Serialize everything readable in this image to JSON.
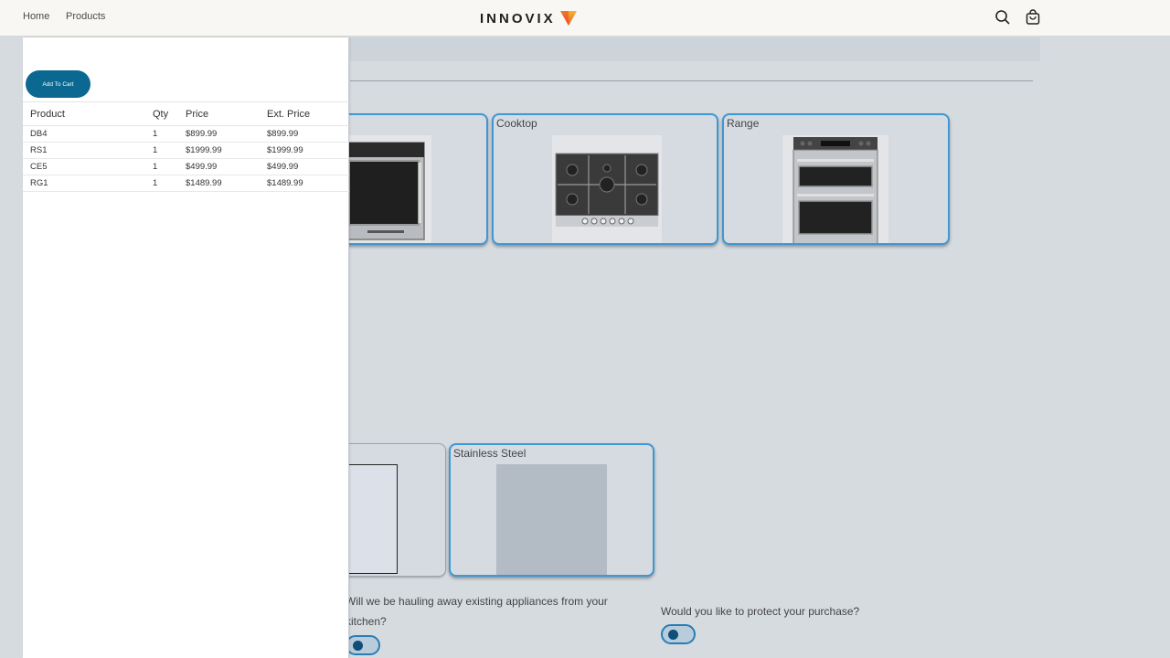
{
  "header": {
    "nav": [
      {
        "label": "Home"
      },
      {
        "label": "Products"
      }
    ],
    "logo_text": "INNOVIX",
    "icons": [
      "search-icon",
      "cart-icon"
    ],
    "logo_colors": [
      "#f05a28",
      "#f7b52c"
    ]
  },
  "product_cards": [
    {
      "label": ""
    },
    {
      "label": "Cooktop"
    },
    {
      "label": "Range"
    }
  ],
  "finish_cards": [
    {
      "label": ""
    },
    {
      "label": "Stainless Steel"
    }
  ],
  "questions": [
    {
      "text_line1": "Will we be hauling away existing appliances from your",
      "text_line2": "kitchen?"
    },
    {
      "text_line1": "Would you like to protect your purchase?"
    }
  ],
  "cart": {
    "add_to_cart_label": "Add To Cart",
    "columns": [
      "Product",
      "Qty",
      "Price",
      "Ext. Price"
    ],
    "rows": [
      {
        "product": "DB4",
        "qty": "1",
        "price": "$899.99",
        "ext_price": "$899.99"
      },
      {
        "product": "RS1",
        "qty": "1",
        "price": "$1999.99",
        "ext_price": "$1999.99"
      },
      {
        "product": "CE5",
        "qty": "1",
        "price": "$499.99",
        "ext_price": "$499.99"
      },
      {
        "product": "RG1",
        "qty": "1",
        "price": "$1489.99",
        "ext_price": "$1489.99"
      }
    ]
  },
  "colors": {
    "accent": "#3e98d3",
    "button": "#0b6891",
    "background": "#d6dbe0"
  }
}
